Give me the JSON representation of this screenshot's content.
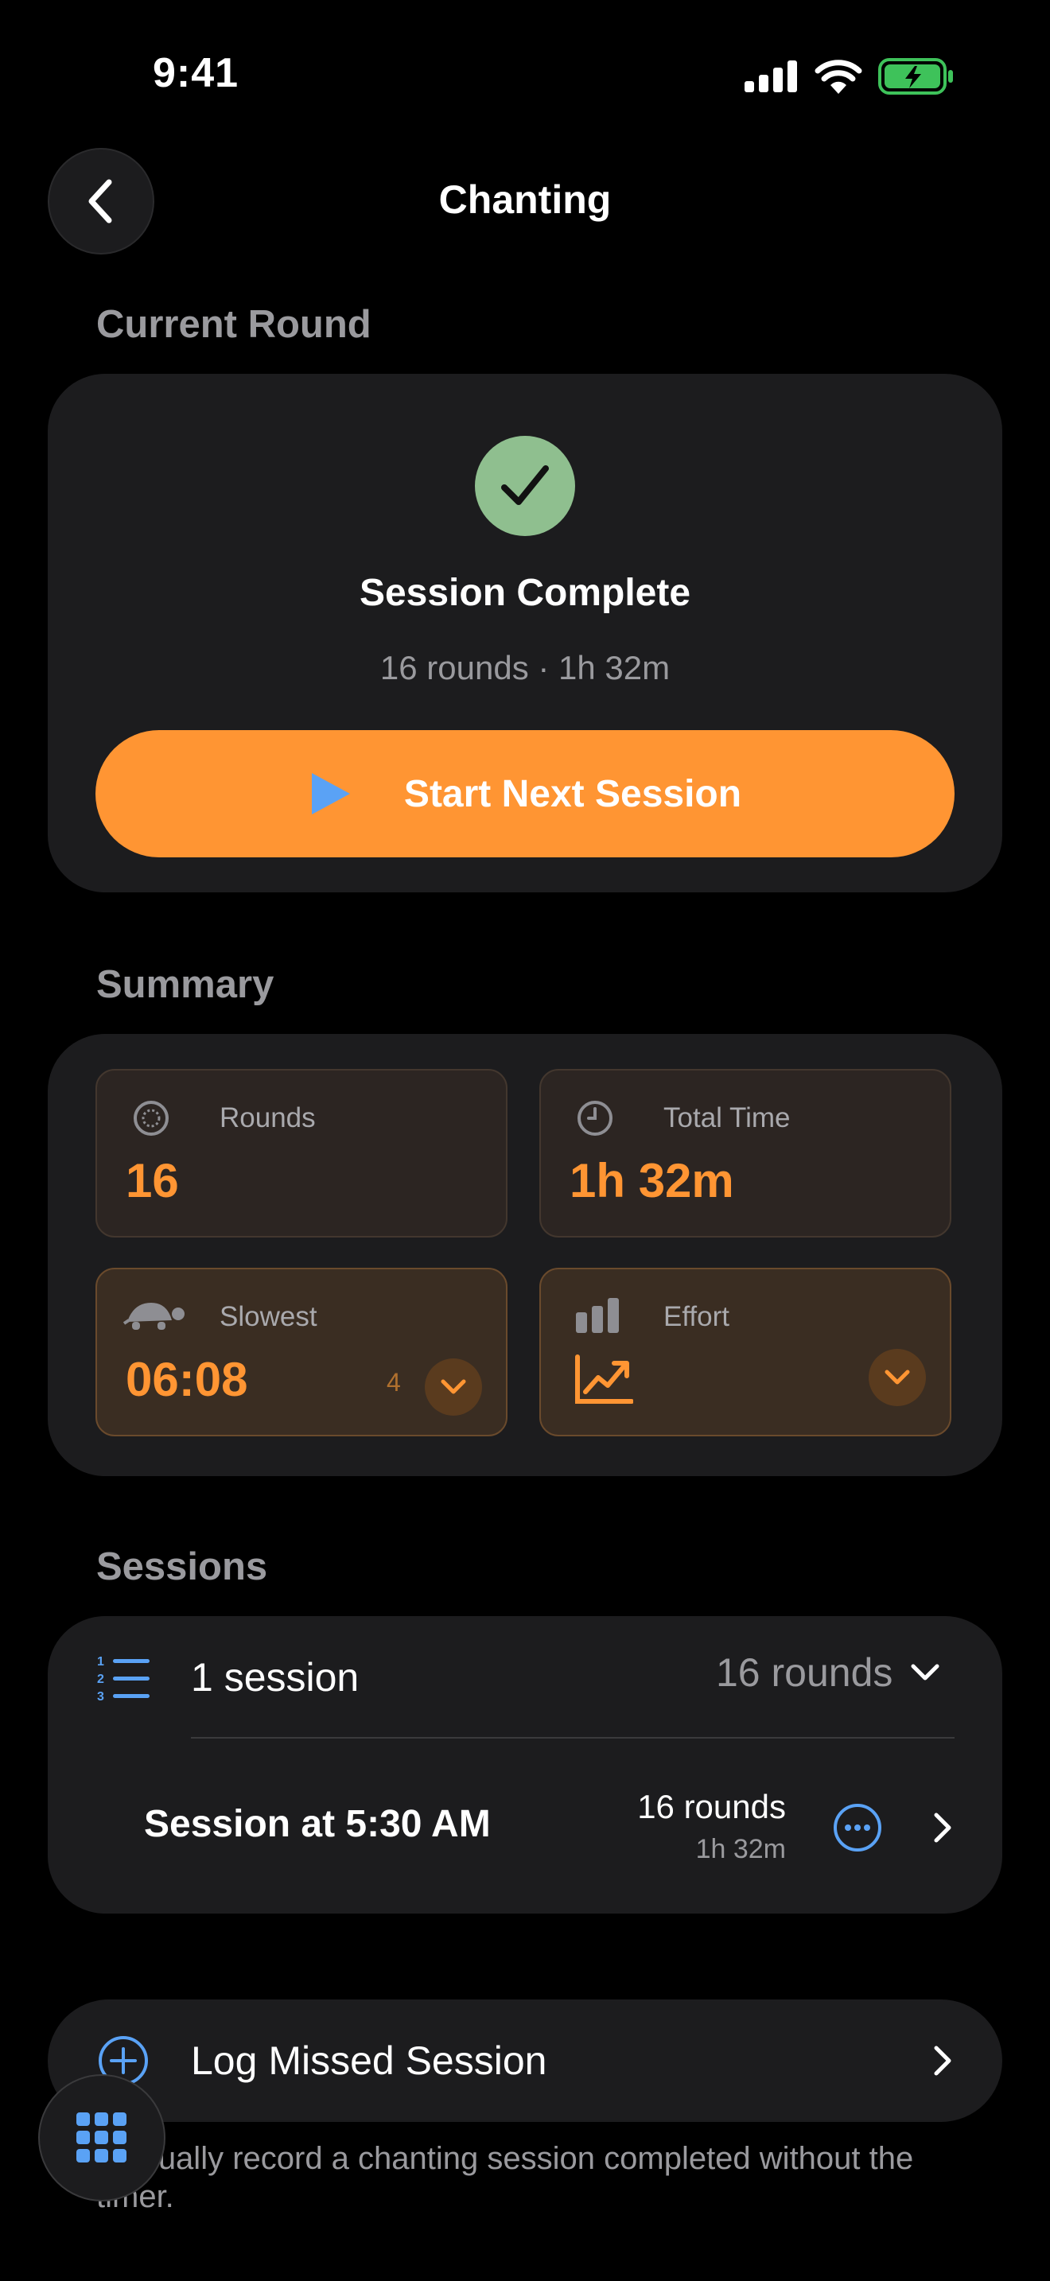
{
  "status_bar": {
    "time": "9:41"
  },
  "nav": {
    "title": "Chanting"
  },
  "current_round": {
    "section_label": "Current Round",
    "title": "Session Complete",
    "subtitle": "16 rounds · 1h 32m",
    "button_label": "Start Next Session",
    "colors": {
      "accent": "#ff9533",
      "success": "#8fbf8f",
      "play_icon": "#5aa2f5"
    }
  },
  "summary": {
    "section_label": "Summary",
    "tiles": [
      {
        "label": "Rounds",
        "value": "16",
        "icon": "rounds-icon"
      },
      {
        "label": "Total Time",
        "value": "1h 32m",
        "icon": "clock-icon"
      },
      {
        "label": "Slowest",
        "value": "06:08",
        "badge": "4",
        "icon": "turtle-icon"
      },
      {
        "label": "Effort",
        "value": "",
        "icon": "bar-chart-icon"
      }
    ]
  },
  "sessions": {
    "section_label": "Sessions",
    "group_label": "1 session",
    "group_rounds": "16 rounds",
    "items": [
      {
        "title": "Session at 5:30 AM",
        "rounds": "16 rounds",
        "duration": "1h 32m"
      }
    ]
  },
  "log_missed": {
    "label": "Log Missed Session",
    "note": "Manually record a chanting session completed without the timer."
  }
}
